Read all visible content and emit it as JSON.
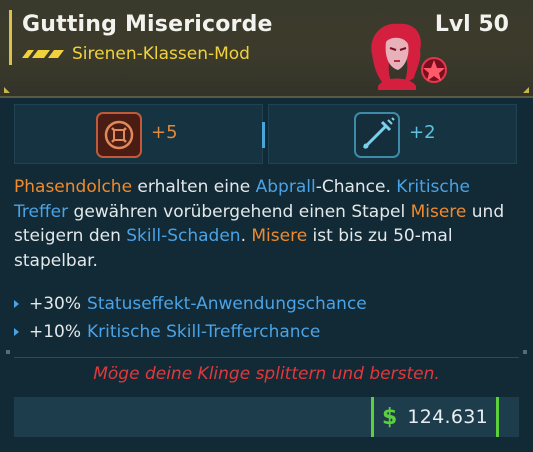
{
  "item": {
    "title": "Gutting Misericorde",
    "level": "Lvl 50",
    "type": "Sirenen-Klassen-Mod",
    "rarity_icon": "rarity-chevrons-icon",
    "portrait_icon": "siren-portrait-icon"
  },
  "stats": [
    {
      "icon": "phase-skill-icon",
      "value": "+5",
      "color": "#e08a3c"
    },
    {
      "icon": "dagger-skill-icon",
      "value": "+2",
      "color": "#5ec3e0"
    }
  ],
  "description": {
    "seg1": "Phasendolche",
    "seg2": " erhalten eine ",
    "seg3": "Abprall",
    "seg4": "-Chance. ",
    "seg5": "Kritische Treffer",
    "seg6": " gewähren vorübergehend einen Stapel ",
    "seg7": "Misere",
    "seg8": " und steigern den ",
    "seg9": "Skill-Schaden",
    "seg10": ". ",
    "seg11": "Misere",
    "seg12": " ist bis zu 50-mal stapelbar."
  },
  "bullets": [
    {
      "value": "+30%",
      "label": "Statuseffekt-Anwendungschance"
    },
    {
      "value": "+10%",
      "label": "Kritische Skill-Trefferchance"
    }
  ],
  "flavor": "Möge deine Klinge splittern und bersten.",
  "price": {
    "symbol": "$",
    "value": "124.631"
  },
  "colors": {
    "accent_yellow": "#f1d23c",
    "highlight_orange": "#f08a2c",
    "highlight_blue": "#4aa3e6",
    "flavor_red": "#e2383c",
    "money_green": "#5cd03a"
  }
}
